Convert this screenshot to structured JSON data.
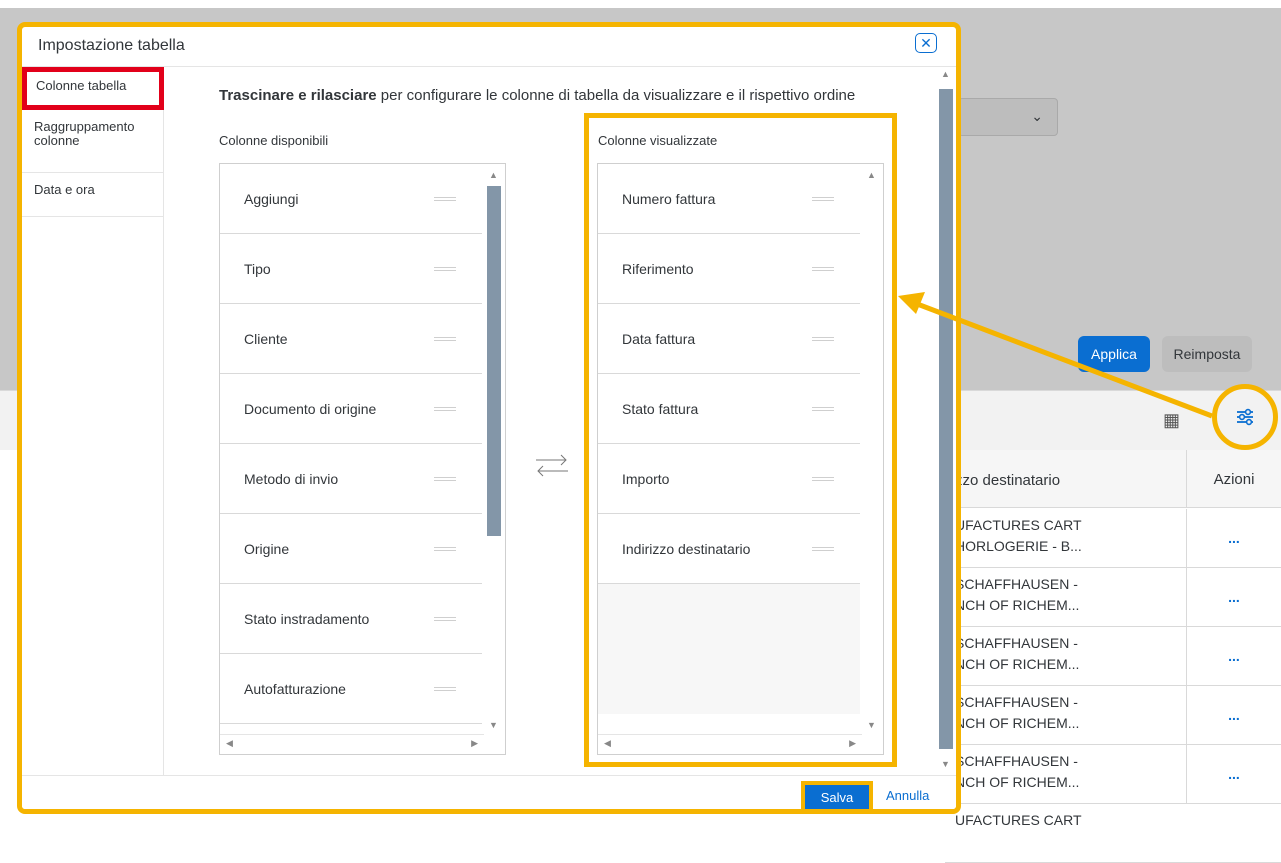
{
  "background": {
    "apply_label": "Applica",
    "reset_label": "Reimposta",
    "column_address": "zzo destinatario",
    "column_actions": "Azioni",
    "rows": [
      "UFACTURES CART\nHORLOGERIE - B...",
      "SCHAFFHAUSEN -\nNCH OF RICHEM...",
      "SCHAFFHAUSEN -\nNCH OF RICHEM...",
      "SCHAFFHAUSEN -\nNCH OF RICHEM...",
      "SCHAFFHAUSEN -\nNCH OF RICHEM...",
      "UFACTURES CART"
    ],
    "row_action": "..."
  },
  "dialog": {
    "title": "Impostazione tabella",
    "nav": [
      "Colonne tabella",
      "Raggruppamento colonne",
      "Data e ora"
    ],
    "instruction_bold": "Trascinare e rilasciare",
    "instruction_rest": " per configurare le colonne di tabella da visualizzare e il rispettivo ordine",
    "available_label": "Colonne disponibili",
    "shown_label": "Colonne visualizzate",
    "available": [
      "Aggiungi",
      "Tipo",
      "Cliente",
      "Documento di origine",
      "Metodo di invio",
      "Origine",
      "Stato instradamento",
      "Autofatturazione"
    ],
    "shown": [
      "Numero fattura",
      "Riferimento",
      "Data fattura",
      "Stato fattura",
      "Importo",
      "Indirizzo destinatario"
    ],
    "save_label": "Salva",
    "cancel_label": "Annulla"
  },
  "colors": {
    "accent": "#0a6ed1",
    "highlight": "#f5b400",
    "red_highlight": "#e2001a"
  }
}
